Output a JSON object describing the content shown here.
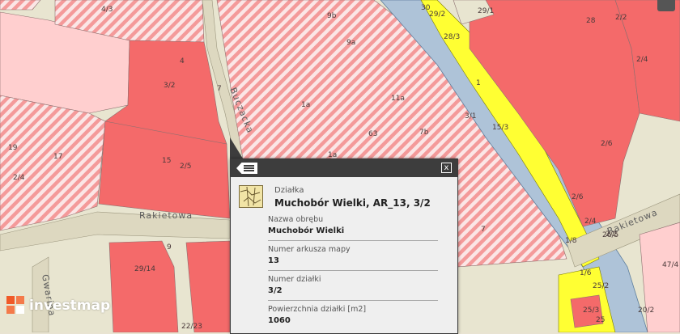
{
  "map": {
    "streets": [
      "Buczacka",
      "Rakietowa",
      "Rakietowa",
      "Gwarina"
    ],
    "plots": [
      "4/3",
      "9b",
      "9a",
      "4",
      "3/2",
      "1a",
      "7",
      "11a",
      "63",
      "7b",
      "1a",
      "15",
      "2/5",
      "19",
      "17",
      "2/4",
      "29/1",
      "30",
      "29/2",
      "28/3",
      "28",
      "2/2",
      "2/4",
      "2/6",
      "2/6",
      "1",
      "3/1",
      "15/3",
      "2/4",
      "26/5",
      "25/2",
      "1/6",
      "25/3",
      "25",
      "47/4",
      "1/8",
      "20/2",
      "9",
      "29/14",
      "22/23",
      "7",
      "2/2"
    ],
    "colors": {
      "road": "#e8e5d0",
      "parcel_red": "#f46a6a",
      "parcel_pink": "#ffcfcf",
      "hatch": "#f4a3a3",
      "river": "#aec3d8",
      "yellow": "#ffff33"
    }
  },
  "popup": {
    "layer_label": "Działka",
    "title": "Muchobór Wielki, AR_13, 3/2",
    "attributes": [
      {
        "label": "Nazwa obrębu",
        "value": "Muchobór Wielki"
      },
      {
        "label": "Numer arkusza mapy",
        "value": "13"
      },
      {
        "label": "Numer działki",
        "value": "3/2"
      },
      {
        "label": "Powierzchnia działki [m2]",
        "value": "1060"
      }
    ],
    "close_symbol": "x",
    "icons": [
      "list-icon",
      "close-icon",
      "parcel-icon"
    ]
  },
  "branding": {
    "logo_text": "investmap"
  },
  "toolbar": {
    "icons": [
      "comment-icon"
    ]
  }
}
